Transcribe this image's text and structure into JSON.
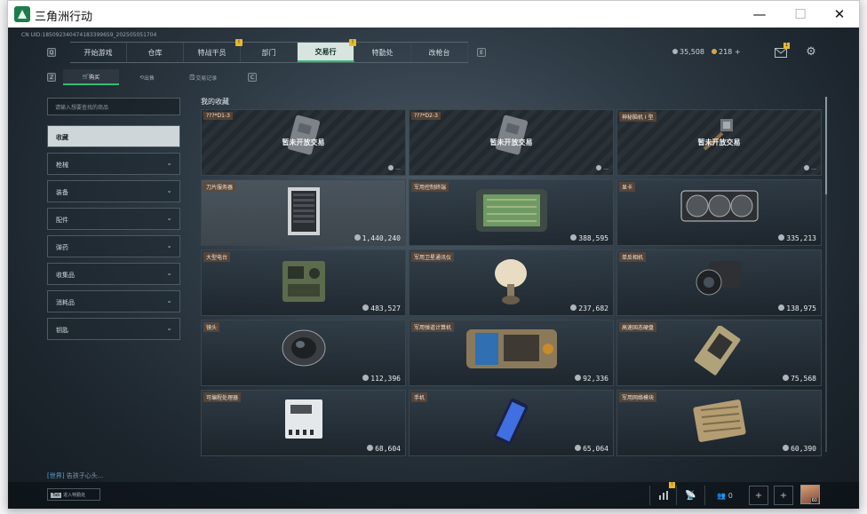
{
  "window": {
    "title": "三角洲行动",
    "minimize": "—",
    "maximize": "☐",
    "close": "✕"
  },
  "uid_text": "CN UID:1850923404741833996S9_202505051704",
  "top_nav": {
    "q_key": "Q",
    "e_key": "E",
    "tabs": [
      {
        "label": "开始游戏",
        "badge": ""
      },
      {
        "label": "仓库",
        "badge": ""
      },
      {
        "label": "特战干员",
        "badge": ""
      },
      {
        "label": "部门",
        "badge": "!"
      },
      {
        "label": "交易行",
        "badge": ""
      },
      {
        "label": "特勤处",
        "badge": "!"
      },
      {
        "label": "改枪台",
        "badge": ""
      }
    ],
    "active_index": 4
  },
  "currency": {
    "silver": "35,508",
    "gold": "218",
    "add": "+"
  },
  "header_icons": {
    "mail_badge": "1"
  },
  "sub_nav": {
    "z_key": "Z",
    "c_key": "C",
    "tabs": [
      {
        "label": "购买"
      },
      {
        "label": "出售"
      },
      {
        "label": "交易记录"
      }
    ],
    "active_index": 0
  },
  "search": {
    "placeholder": "请输入想要查找的商品"
  },
  "categories": [
    {
      "label": "收藏",
      "expandable": false
    },
    {
      "label": "枪械",
      "expandable": true
    },
    {
      "label": "装备",
      "expandable": true
    },
    {
      "label": "配件",
      "expandable": true
    },
    {
      "label": "弹药",
      "expandable": true
    },
    {
      "label": "收集品",
      "expandable": true
    },
    {
      "label": "消耗品",
      "expandable": true
    },
    {
      "label": "钥匙",
      "expandable": true
    }
  ],
  "section_title": "我的收藏",
  "items": [
    {
      "name": "???*D1-3",
      "price": "",
      "status": "暂未开放交易",
      "icon": "keycard"
    },
    {
      "name": "???*D2-3",
      "price": "",
      "status": "暂未开放交易",
      "icon": "keycard"
    },
    {
      "name": "神秘脑机 I 型",
      "price": "",
      "status": "暂未开放交易",
      "icon": "chip"
    },
    {
      "name": "刀片服务器",
      "price": "1,440,240",
      "status": "",
      "icon": "server"
    },
    {
      "name": "军用控制终端",
      "price": "388,595",
      "status": "",
      "icon": "terminal"
    },
    {
      "name": "显卡",
      "price": "335,213",
      "status": "",
      "icon": "gpu"
    },
    {
      "name": "大型电台",
      "price": "483,527",
      "status": "",
      "icon": "radio"
    },
    {
      "name": "军用卫星通讯仪",
      "price": "237,682",
      "status": "",
      "icon": "satellite"
    },
    {
      "name": "单反相机",
      "price": "138,975",
      "status": "",
      "icon": "camera"
    },
    {
      "name": "镜头",
      "price": "112,396",
      "status": "",
      "icon": "lens"
    },
    {
      "name": "军用弹道计算机",
      "price": "92,336",
      "status": "",
      "icon": "ballistic"
    },
    {
      "name": "高速固态硬盘",
      "price": "75,568",
      "status": "",
      "icon": "ssd"
    },
    {
      "name": "可编程处理器",
      "price": "68,604",
      "status": "",
      "icon": "plc"
    },
    {
      "name": "手机",
      "price": "65,064",
      "status": "",
      "icon": "phone"
    },
    {
      "name": "军用网络模块",
      "price": "60,390",
      "status": "",
      "icon": "module"
    }
  ],
  "chat": {
    "channel": "[世界]",
    "text": "告孩子心头..."
  },
  "bottom": {
    "tab_key": "Tab",
    "tab_label": "进入特勤处",
    "stats_badge": "!",
    "friends_count": "0",
    "avatar_level": "60"
  },
  "colors": {
    "accent": "#2fbf72",
    "badge": "#e7b92c"
  }
}
